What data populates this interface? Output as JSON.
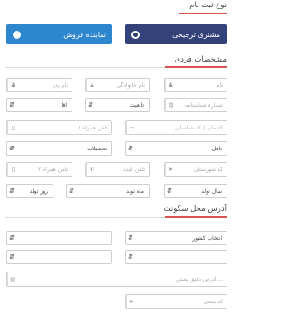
{
  "sections": {
    "registration_type": "نوع ثبت نام",
    "personal_info": "مشخصات فردی",
    "address": "آدرس محل سکونت"
  },
  "registration": {
    "preferred_customer": "مشتری ترجیحی",
    "sales_agent": "نماینده فروش"
  },
  "personal": {
    "first_name": "نام",
    "last_name": "نام خانوادگی",
    "father_name": "نام پدر",
    "id_number": "شماره شناسنامه",
    "nationality": "تابعیت",
    "gender": "آقا",
    "national_code": "کد ملی / کد شناسایی",
    "mobile": "تلفن همراه ١",
    "marital_status": "تاهل",
    "education": "تحصیلات",
    "city_code": "کد شهرستان",
    "landline": "تلفن ثابت",
    "mobile2": "تلفن همراه ٢",
    "birth_year": "سال تولد",
    "birth_month": "ماه تولد",
    "birth_day": "روز تولد"
  },
  "address": {
    "country": "انتخاب کشور",
    "full_address": "آدرس دقیق پستی ...",
    "postal_code": "کد پستی"
  },
  "colors": {
    "accent_red": "#d9534f",
    "preferred_button": "#34427a",
    "agent_button": "#2e86cf"
  }
}
